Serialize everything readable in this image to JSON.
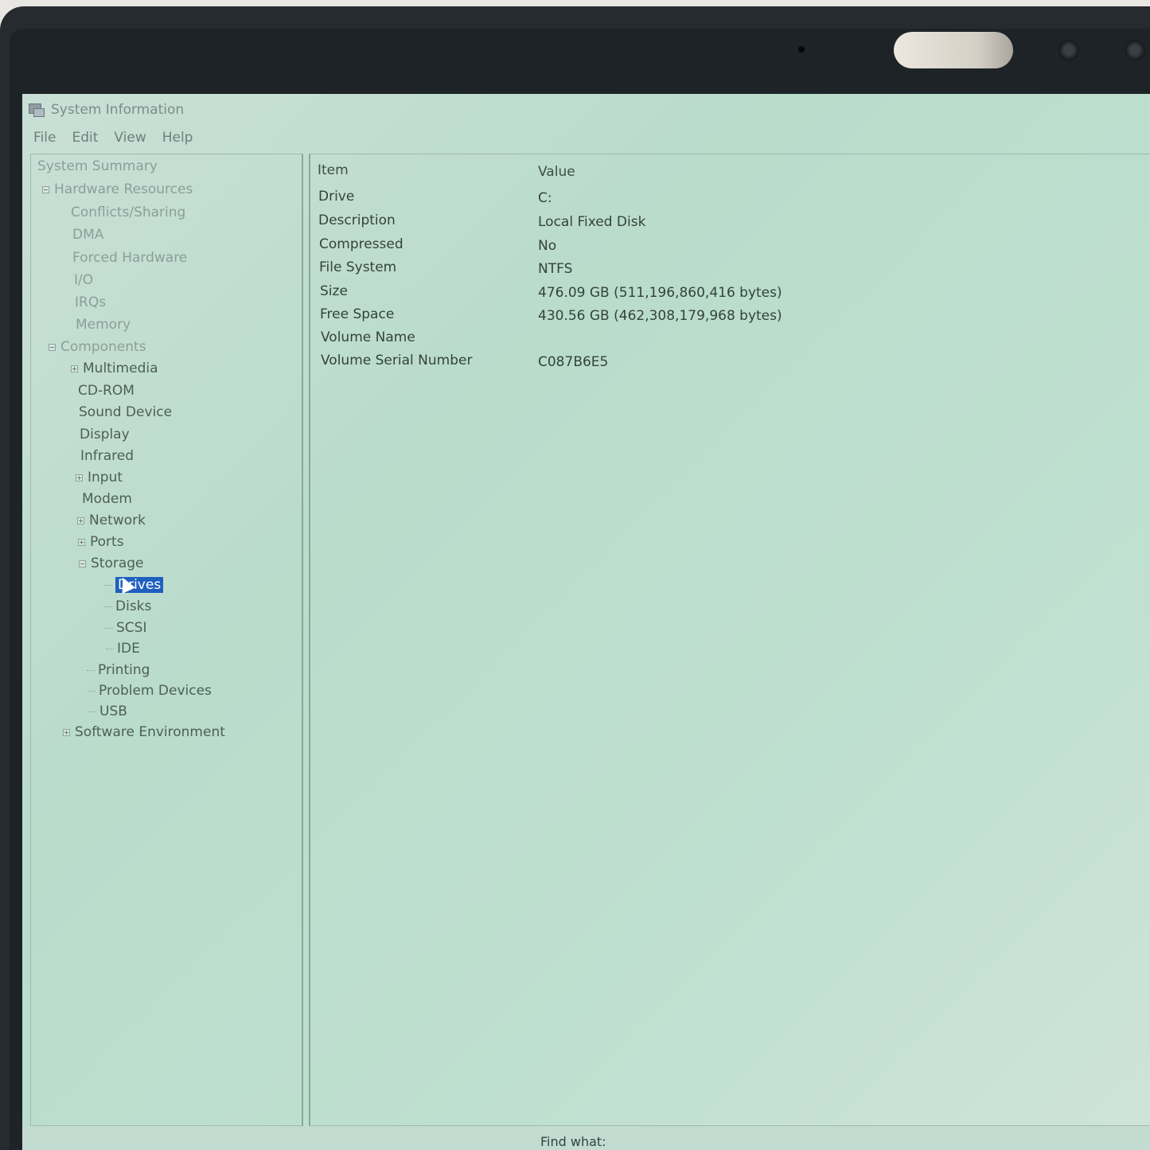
{
  "window": {
    "title": "System Information"
  },
  "menu": [
    "File",
    "Edit",
    "View",
    "Help"
  ],
  "tree": [
    {
      "label": "System Summary",
      "expander": "none"
    },
    {
      "label": "Hardware Resources",
      "expander": "minus"
    },
    {
      "label": "Conflicts/Sharing",
      "expander": "none"
    },
    {
      "label": "DMA",
      "expander": "none"
    },
    {
      "label": "Forced Hardware",
      "expander": "none"
    },
    {
      "label": "I/O",
      "expander": "none"
    },
    {
      "label": "IRQs",
      "expander": "none"
    },
    {
      "label": "Memory",
      "expander": "none"
    },
    {
      "label": "Components",
      "expander": "minus"
    },
    {
      "label": "Multimedia",
      "expander": "plus"
    },
    {
      "label": "CD-ROM",
      "expander": "none"
    },
    {
      "label": "Sound Device",
      "expander": "none"
    },
    {
      "label": "Display",
      "expander": "none"
    },
    {
      "label": "Infrared",
      "expander": "none"
    },
    {
      "label": "Input",
      "expander": "plus"
    },
    {
      "label": "Modem",
      "expander": "none"
    },
    {
      "label": "Network",
      "expander": "plus"
    },
    {
      "label": "Ports",
      "expander": "plus"
    },
    {
      "label": "Storage",
      "expander": "minus"
    },
    {
      "label": "Drives",
      "expander": "none",
      "selected": true
    },
    {
      "label": "Disks",
      "expander": "none"
    },
    {
      "label": "SCSI",
      "expander": "none"
    },
    {
      "label": "IDE",
      "expander": "none"
    },
    {
      "label": "Printing",
      "expander": "none"
    },
    {
      "label": "Problem Devices",
      "expander": "none"
    },
    {
      "label": "USB",
      "expander": "none"
    },
    {
      "label": "Software Environment",
      "expander": "plus"
    }
  ],
  "details": {
    "headers": {
      "item": "Item",
      "value": "Value"
    },
    "rows": [
      {
        "item": "Drive",
        "value": "C:"
      },
      {
        "item": "Description",
        "value": "Local Fixed Disk"
      },
      {
        "item": "Compressed",
        "value": "No"
      },
      {
        "item": "File System",
        "value": "NTFS"
      },
      {
        "item": "Size",
        "value": "476.09 GB (511,196,860,416 bytes)"
      },
      {
        "item": "Free Space",
        "value": "430.56 GB (462,308,179,968 bytes)"
      },
      {
        "item": "Volume Name",
        "value": ""
      },
      {
        "item": "Volume Serial Number",
        "value": "C087B6E5"
      }
    ]
  },
  "findbar": {
    "label": "Find what:"
  }
}
